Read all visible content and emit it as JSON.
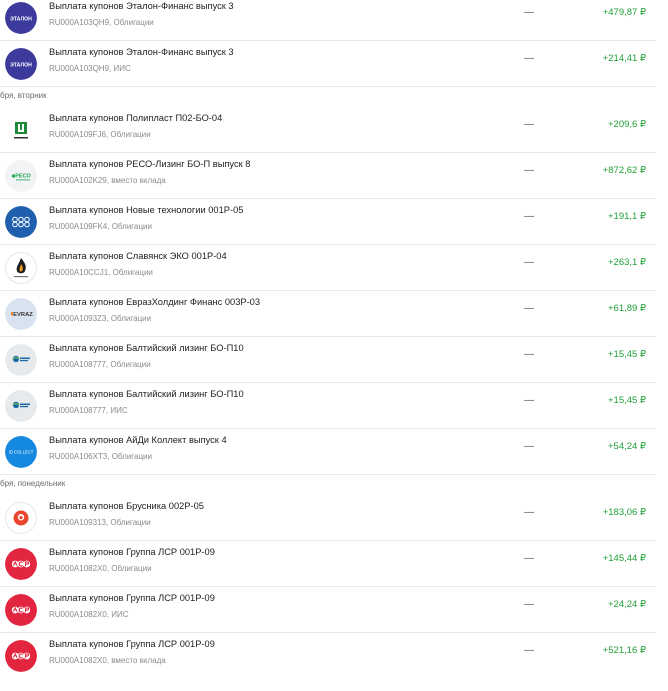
{
  "colors": {
    "positive": "#21a038",
    "text": "#222222",
    "muted": "#8b8b8b",
    "divider": "#e9e9ec"
  },
  "sections": [
    {
      "date": "",
      "items": [
        {
          "title": "Выплата купонов Эталон-Финанс выпуск 3",
          "subtitle": "RU000A103QH9, Облигации",
          "mid": "—",
          "amount": "+479,87 ₽",
          "logo": "etalon-logo-icon",
          "logo_text": "ЭТАЛОН"
        },
        {
          "title": "Выплата купонов Эталон-Финанс выпуск 3",
          "subtitle": "RU000A103QH9, ИИС",
          "mid": "—",
          "amount": "+214,41 ₽",
          "logo": "etalon-logo-icon",
          "logo_text": "ЭТАЛОН"
        }
      ]
    },
    {
      "date": "бря, вторник",
      "items": [
        {
          "title": "Выплата купонов Полипласт П02-БО-04",
          "subtitle": "RU000A109FJ6, Облигации",
          "mid": "—",
          "amount": "+209,6 ₽",
          "logo": "poliplast-logo-icon",
          "logo_text": ""
        },
        {
          "title": "Выплата купонов РЕСО-Лизинг БО-П выпуск 8",
          "subtitle": "RU000A102K29, вместо вклада",
          "mid": "—",
          "amount": "+872,62 ₽",
          "logo": "reso-logo-icon",
          "logo_text": "РЕСО"
        },
        {
          "title": "Выплата купонов Новые технологии 001Р-05",
          "subtitle": "RU000A109FK4, Облигации",
          "mid": "—",
          "amount": "+191,1 ₽",
          "logo": "newtech-logo-icon",
          "logo_text": ""
        },
        {
          "title": "Выплата купонов Славянск ЭКО 001Р-04",
          "subtitle": "RU000A10CCJ1, Облигации",
          "mid": "—",
          "amount": "+263,1 ₽",
          "logo": "slavyansk-logo-icon",
          "logo_text": ""
        },
        {
          "title": "Выплата купонов ЕвразХолдинг Финанс 003Р-03",
          "subtitle": "RU000A1093Z3, Облигации",
          "mid": "—",
          "amount": "+61,89 ₽",
          "logo": "evraz-logo-icon",
          "logo_text": "EVRAZ"
        },
        {
          "title": "Выплата купонов Балтийский лизинг БО-П10",
          "subtitle": "RU000A108777, Облигации",
          "mid": "—",
          "amount": "+15,45 ₽",
          "logo": "baltic-leasing-logo-icon",
          "logo_text": ""
        },
        {
          "title": "Выплата купонов Балтийский лизинг БО-П10",
          "subtitle": "RU000A108777, ИИС",
          "mid": "—",
          "amount": "+15,45 ₽",
          "logo": "baltic-leasing-logo-icon",
          "logo_text": ""
        },
        {
          "title": "Выплата купонов АйДи Коллект выпуск 4",
          "subtitle": "RU000A106XT3, Облигации",
          "mid": "—",
          "amount": "+54,24 ₽",
          "logo": "idcollect-logo-icon",
          "logo_text": "ID COLLECT"
        }
      ]
    },
    {
      "date": "бря, понедельник",
      "items": [
        {
          "title": "Выплата купонов Брусника 002Р-05",
          "subtitle": "RU000A109313, Облигации",
          "mid": "—",
          "amount": "+183,06 ₽",
          "logo": "brusnika-logo-icon",
          "logo_text": ""
        },
        {
          "title": "Выплата купонов Группа ЛСР 001Р-09",
          "subtitle": "RU000A1082X0, Облигации",
          "mid": "—",
          "amount": "+145,44 ₽",
          "logo": "lsr-logo-icon",
          "logo_text": ""
        },
        {
          "title": "Выплата купонов Группа ЛСР 001Р-09",
          "subtitle": "RU000A1082X0, ИИС",
          "mid": "—",
          "amount": "+24,24 ₽",
          "logo": "lsr-logo-icon",
          "logo_text": ""
        },
        {
          "title": "Выплата купонов Группа ЛСР 001Р-09",
          "subtitle": "RU000A1082X0, вместо вклада",
          "mid": "—",
          "amount": "+521,16 ₽",
          "logo": "lsr-logo-icon",
          "logo_text": ""
        }
      ]
    }
  ]
}
